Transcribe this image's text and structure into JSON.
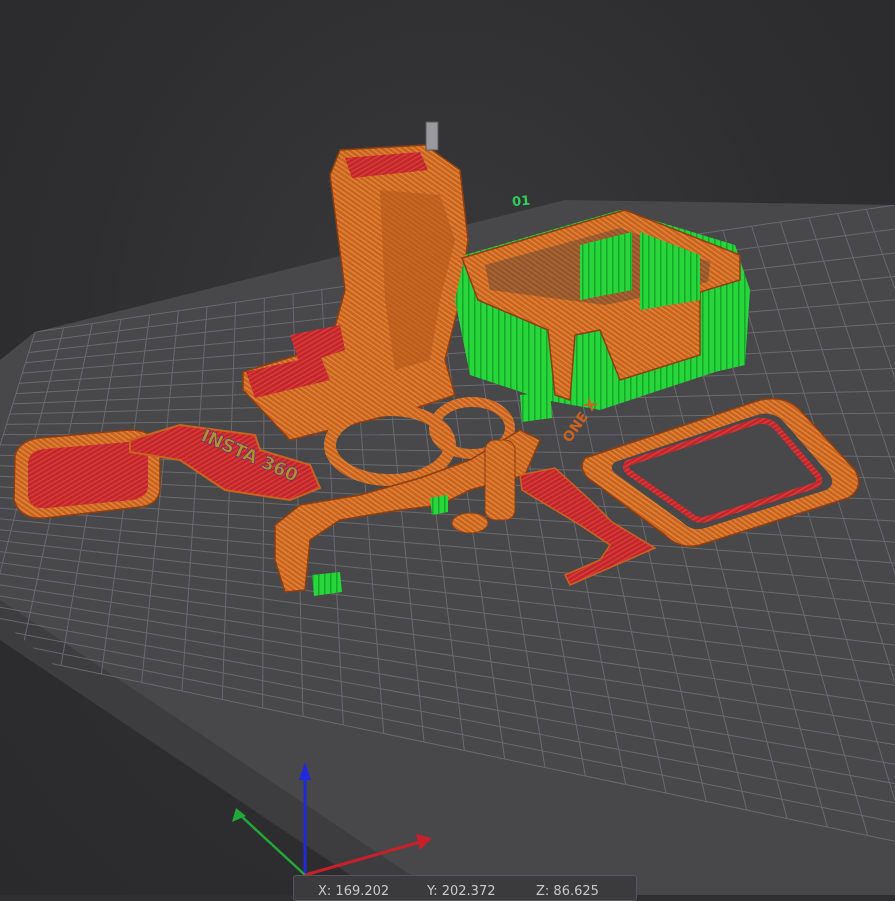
{
  "viewport": {
    "plate_label": "01",
    "text_on_parts": {
      "logo_text": "INSTA 360",
      "side_text": "ONE X"
    }
  },
  "coordinates": {
    "x": "X: 169.202",
    "y": "Y: 202.372",
    "z": "Z: 86.625"
  },
  "colors": {
    "background": "#2f2f31",
    "plate": "#48484b",
    "grid": "#6f6f73",
    "perimeter": "#c9631f",
    "infill": "#c2262a",
    "support": "#27d63b",
    "axis_x": "#c8202a",
    "axis_y": "#22a83a",
    "axis_z": "#1f2ad8"
  }
}
